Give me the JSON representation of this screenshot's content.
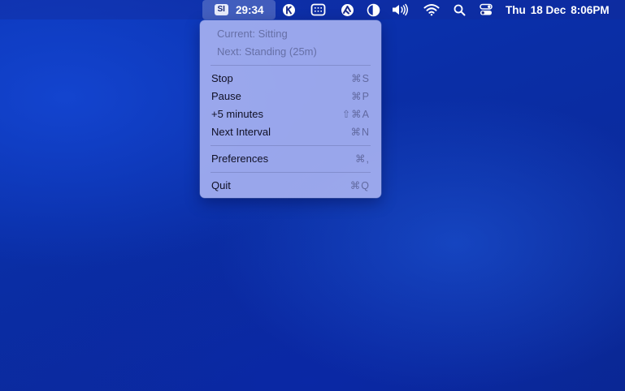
{
  "menubar": {
    "app_badge": "SI",
    "app_timer": "29:34",
    "icons": [
      "k-app-icon",
      "display-mirror-icon",
      "stats-icon",
      "contrast-icon",
      "volume-icon",
      "wifi-icon",
      "search-icon",
      "control-center-icon"
    ],
    "clock": {
      "day": "Thu",
      "date": "18 Dec",
      "time": "8:06PM"
    }
  },
  "menu": {
    "info": {
      "current": "Current: Sitting",
      "next": "Next: Standing (25m)"
    },
    "items": [
      {
        "label": "Stop",
        "shortcut": "⌘S"
      },
      {
        "label": "Pause",
        "shortcut": "⌘P"
      },
      {
        "label": "+5 minutes",
        "shortcut": "⇧⌘A"
      },
      {
        "label": "Next Interval",
        "shortcut": "⌘N"
      },
      {
        "label": "Preferences",
        "shortcut": "⌘,"
      },
      {
        "label": "Quit",
        "shortcut": "⌘Q"
      }
    ]
  },
  "colors": {
    "desktop": "#0a2ea6",
    "menu_bg": "#a5aff0",
    "menu_text": "#101025"
  }
}
